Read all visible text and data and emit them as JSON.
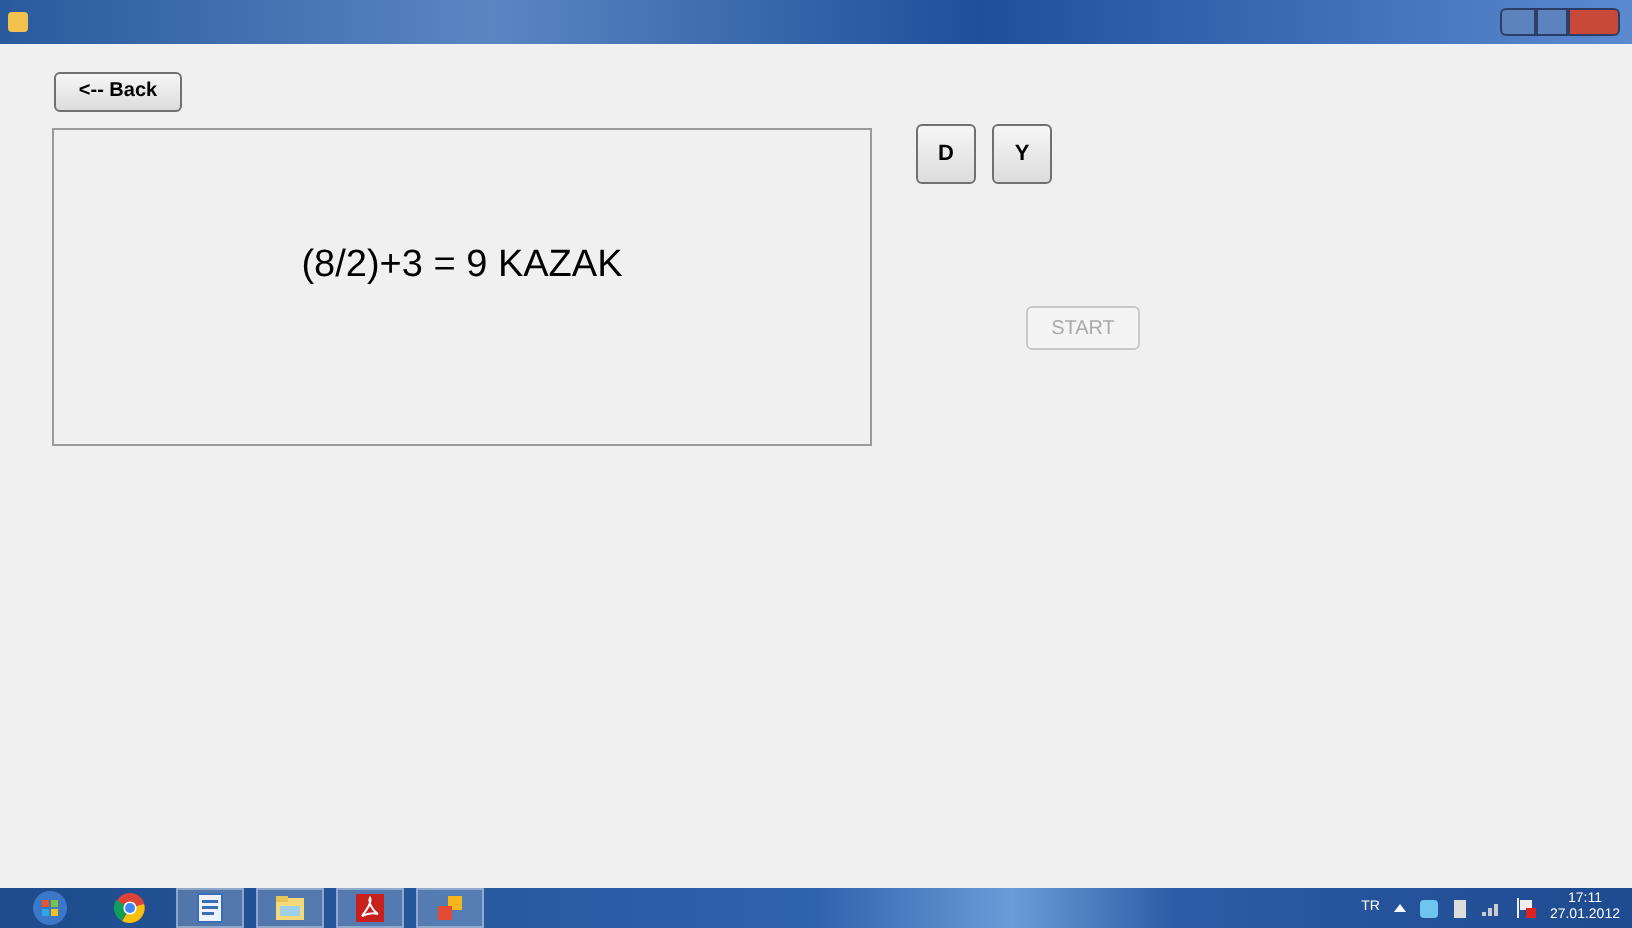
{
  "back_button": {
    "label": "<-- Back"
  },
  "display": {
    "text": "(8/2)+3 = 9 KAZAK"
  },
  "answer_buttons": [
    {
      "label": "D"
    },
    {
      "label": "Y"
    }
  ],
  "start_button": {
    "label": "START",
    "disabled": true
  },
  "taskbar": {
    "apps": [
      {
        "kind": "browser",
        "active": false
      },
      {
        "kind": "word",
        "active": true
      },
      {
        "kind": "folder",
        "active": true
      },
      {
        "kind": "pdf",
        "active": true
      },
      {
        "kind": "app",
        "active": true
      }
    ],
    "language": "TR",
    "time": "17:11",
    "date": "27.01.2012"
  }
}
